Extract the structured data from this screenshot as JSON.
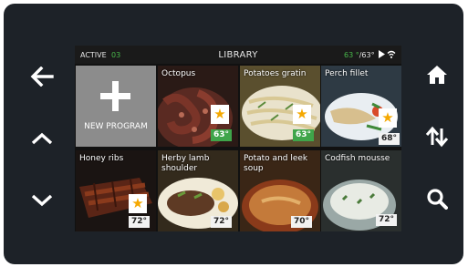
{
  "status": {
    "active": "ACTIVE",
    "count": "03",
    "title": "LIBRARY",
    "temp_current": "63 °",
    "temp_target": "/63°",
    "play_icon": "play-icon",
    "wifi_icon": "wifi-icon"
  },
  "nav": {
    "back_icon": "arrow-left-icon",
    "up_icon": "chevron-up-icon",
    "down_icon": "chevron-down-icon",
    "home_icon": "home-icon",
    "sort_icon": "sort-icon",
    "search_icon": "search-icon"
  },
  "new_program": {
    "label": "NEW PROGRAM"
  },
  "recipes": [
    {
      "name": "Octopus",
      "temp": "63°",
      "favorite": true,
      "temp_style": "green"
    },
    {
      "name": "Potatoes gratin",
      "temp": "63°",
      "favorite": true,
      "temp_style": "green"
    },
    {
      "name": "Perch fillet",
      "temp": "68°",
      "favorite": true,
      "temp_style": "white"
    },
    {
      "name": "Honey ribs",
      "temp": "72°",
      "favorite": true,
      "temp_style": "white"
    },
    {
      "name": "Herby lamb shoulder",
      "temp": "72°",
      "favorite": false,
      "temp_style": "white"
    },
    {
      "name": "Potato and leek soup",
      "temp": "70°",
      "favorite": false,
      "temp_style": "white"
    },
    {
      "name": "Codfish mousse",
      "temp": "72°",
      "favorite": false,
      "temp_style": "white"
    }
  ],
  "colors": {
    "bezel": "#1d2228",
    "accent_green": "#48b84a",
    "star": "#f5a800"
  }
}
